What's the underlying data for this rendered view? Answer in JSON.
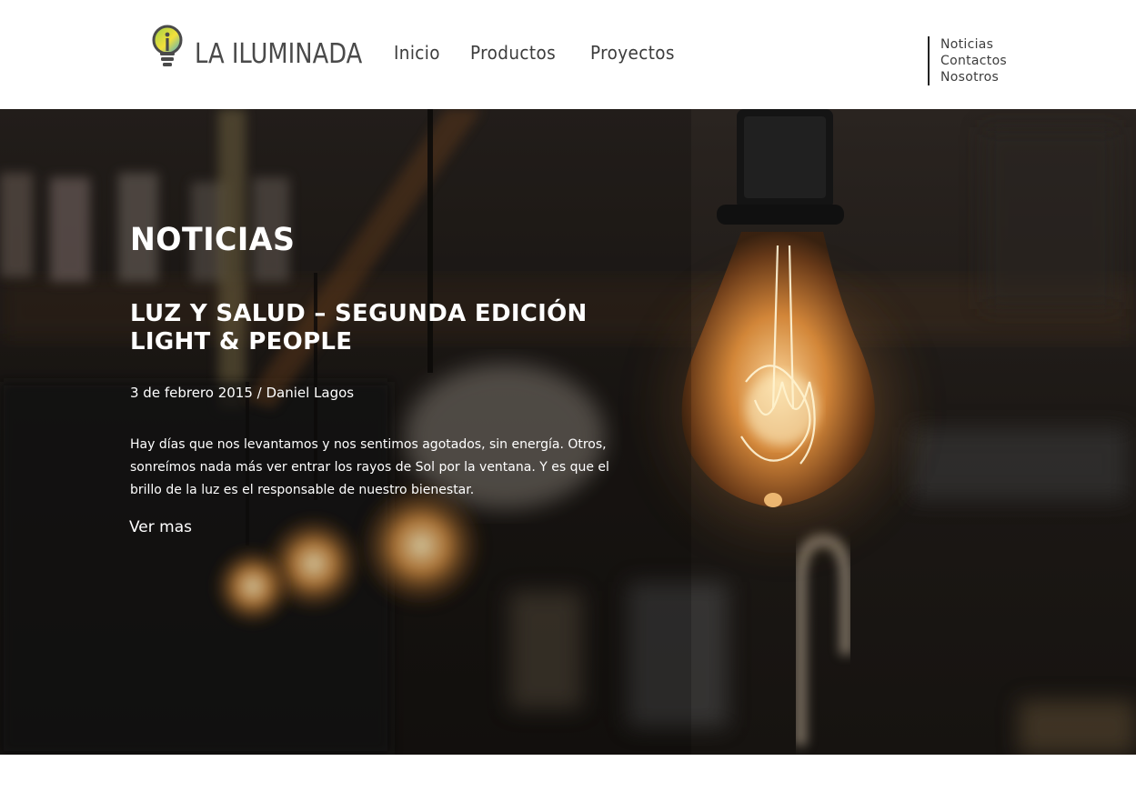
{
  "header": {
    "logo_text": "LA ILUMINADA",
    "main_nav": [
      "Inicio",
      "Productos",
      "Proyectos"
    ],
    "side_nav": [
      "Noticias",
      "Contactos",
      "Nosotros"
    ]
  },
  "hero": {
    "section_title": "NOTICIAS",
    "article_title": "LUZ Y SALUD – SEGUNDA EDICIÓN LIGHT & PEOPLE",
    "meta": "3 de febrero 2015 / Daniel Lagos",
    "excerpt": "Hay días que nos levantamos y nos sentimos agotados, sin energía. Otros, sonreímos nada más ver entrar los rayos de Sol por la ventana. Y es que el brillo de la luz es el responsable de nuestro bienestar.",
    "read_more": "Ver mas"
  },
  "colors": {
    "nav_text": "#3c3c3c",
    "hero_text": "#ffffff",
    "bulb_glow": "#f5a24a"
  },
  "icons": {
    "logo": "lightbulb-icon"
  }
}
